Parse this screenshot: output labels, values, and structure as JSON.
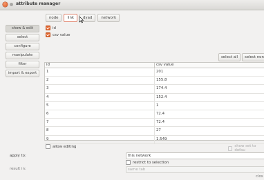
{
  "window": {
    "title": "attribute manager"
  },
  "toolbar": {
    "tabs": [
      "node",
      "link",
      "dyad",
      "network"
    ]
  },
  "sidebar": {
    "items": [
      "show & edit",
      "select",
      "configure",
      "manipulate",
      "filter",
      "import & export"
    ]
  },
  "attributes": {
    "items": [
      {
        "label": "id",
        "checked": true
      },
      {
        "label": "csv value",
        "checked": true
      }
    ]
  },
  "select_buttons": {
    "select_all": "select all",
    "select_none": "select none"
  },
  "table": {
    "columns": [
      "id",
      "csv value"
    ],
    "rows": [
      {
        "id": "1",
        "value": "201"
      },
      {
        "id": "2",
        "value": "155.8"
      },
      {
        "id": "3",
        "value": "174.4"
      },
      {
        "id": "4",
        "value": "152.4"
      },
      {
        "id": "5",
        "value": "1"
      },
      {
        "id": "6",
        "value": "72.4"
      },
      {
        "id": "7",
        "value": "72.4"
      },
      {
        "id": "8",
        "value": "27"
      },
      {
        "id": "9",
        "value": "1.549"
      }
    ]
  },
  "allow_editing": "allow editing",
  "show_set_default": "show set to defau",
  "apply_to": {
    "label": "apply to:",
    "value": "this network",
    "restrict": "restrict to selection"
  },
  "result_in": {
    "label": "result in:",
    "placeholder": "same tab"
  },
  "close_label": "clos"
}
